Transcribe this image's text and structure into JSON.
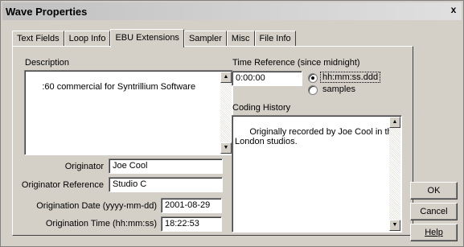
{
  "window": {
    "title": "Wave Properties",
    "close_glyph": "x"
  },
  "tabs": [
    {
      "label": "Text Fields"
    },
    {
      "label": "Loop Info"
    },
    {
      "label": "EBU Extensions"
    },
    {
      "label": "Sampler"
    },
    {
      "label": "Misc"
    },
    {
      "label": "File Info"
    }
  ],
  "active_tab": "EBU Extensions",
  "description": {
    "label": "Description",
    "value": ":60 commercial for Syntrillium Software"
  },
  "originator": {
    "label": "Originator",
    "value": "Joe Cool"
  },
  "originator_reference": {
    "label": "Originator Reference",
    "value": "Studio C"
  },
  "origination_date": {
    "label": "Origination Date (yyyy-mm-dd)",
    "value": "2001-08-29"
  },
  "origination_time": {
    "label": "Origination Time (hh:mm:ss)",
    "value": "18:22:53"
  },
  "time_reference": {
    "label": "Time Reference (since midnight)",
    "value": "0:00:00",
    "options": [
      {
        "label": "hh:mm:ss.ddd",
        "checked": true
      },
      {
        "label": "samples",
        "checked": false
      }
    ]
  },
  "coding_history": {
    "label": "Coding History",
    "value": "Originally recorded by Joe Cool in the\nLondon studios."
  },
  "buttons": {
    "ok": "OK",
    "cancel": "Cancel",
    "help": "Help"
  }
}
